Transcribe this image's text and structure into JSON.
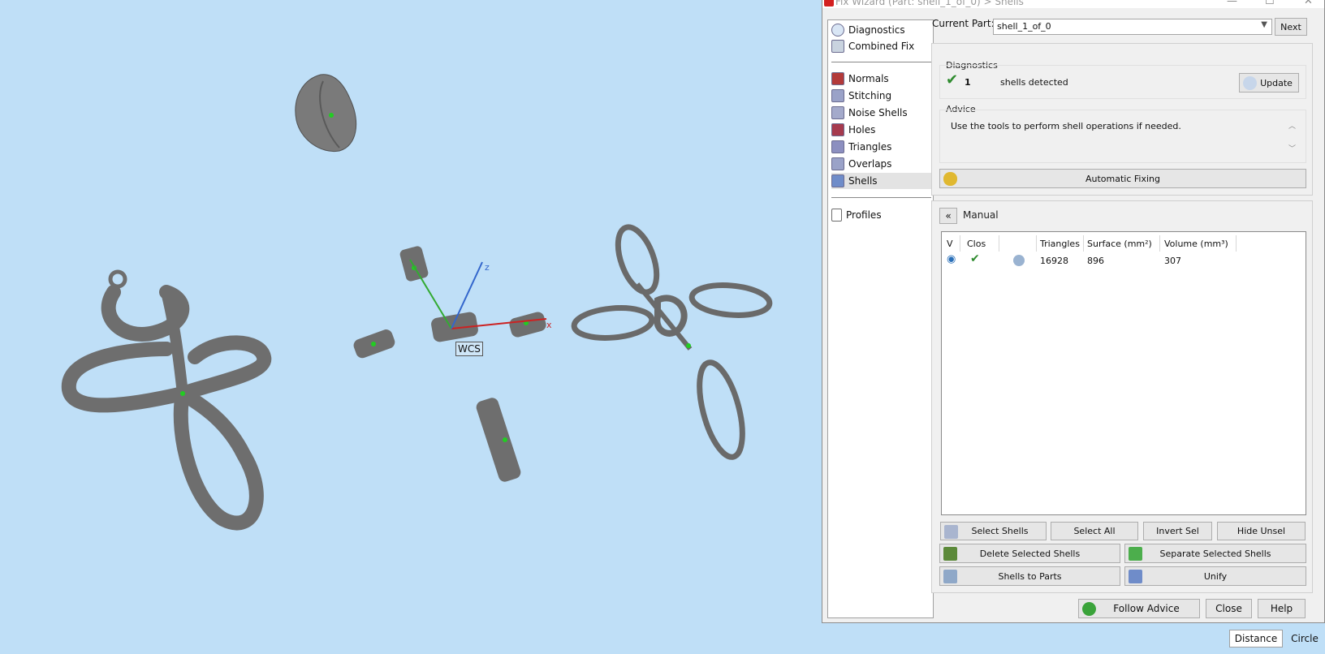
{
  "window": {
    "title": "Fix Wizard (Part: shell_1_of_0) > Shells",
    "minimize": "—",
    "maximize": "☐",
    "close": "✕"
  },
  "nav": {
    "items": [
      {
        "label": "Diagnostics",
        "icon": "magnifier-icon"
      },
      {
        "label": "Combined Fix",
        "icon": "combined-fix-icon"
      },
      {
        "label": "Normals",
        "icon": "normals-cube-icon"
      },
      {
        "label": "Stitching",
        "icon": "stitching-cube-icon"
      },
      {
        "label": "Noise Shells",
        "icon": "noise-shells-cube-icon"
      },
      {
        "label": "Holes",
        "icon": "holes-cube-icon"
      },
      {
        "label": "Triangles",
        "icon": "triangles-cube-icon"
      },
      {
        "label": "Overlaps",
        "icon": "overlaps-cube-icon"
      },
      {
        "label": "Shells",
        "icon": "shells-cube-icon",
        "selected": true
      },
      {
        "label": "Profiles",
        "icon": "profiles-icon"
      }
    ]
  },
  "current_part": {
    "label": "Current Part:",
    "value": "shell_1_of_0",
    "next_label": "Next"
  },
  "diagnostics": {
    "title": "Diagnostics",
    "count": "1",
    "status_text": "shells detected",
    "update_label": "Update"
  },
  "advice": {
    "title": "Advice",
    "text": "Use the tools to perform shell operations if needed."
  },
  "automatic_fixing_label": "Automatic Fixing",
  "manual": {
    "title": "Manual",
    "columns": [
      "V",
      "Clos",
      "Triangles",
      "Surface (mm²)",
      "Volume (mm³)"
    ],
    "rows": [
      {
        "triangles": "16928",
        "surface": "896",
        "volume": "307"
      }
    ]
  },
  "actions": {
    "select_shells": "Select Shells",
    "select_all": "Select All",
    "invert_sel": "Invert Sel",
    "hide_unsel": "Hide Unsel",
    "delete_selected": "Delete Selected Shells",
    "separate_selected": "Separate Selected Shells",
    "shells_to_parts": "Shells to Parts",
    "unify": "Unify"
  },
  "footer": {
    "follow_advice": "Follow Advice",
    "close": "Close",
    "help": "Help"
  },
  "viewport": {
    "wcs_label": "WCS",
    "axis_x": "x",
    "axis_z": "z"
  },
  "bottom_tabs": [
    "Distance",
    "Circle"
  ],
  "colors": {
    "viewport_bg": "#bfdff7",
    "model_grey": "#6e6e6e",
    "check_green": "#2e8b2e",
    "axis_x": "#cc2222",
    "axis_y": "#33aa33",
    "axis_z": "#3366cc"
  }
}
